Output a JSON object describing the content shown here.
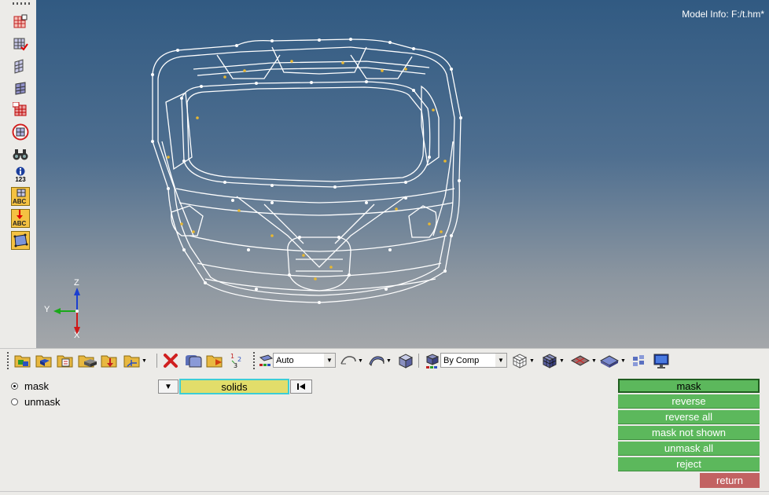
{
  "viewport": {
    "model_info": "Model Info: F:/t.hm*",
    "axis": {
      "z": "Z",
      "y": "Y",
      "x": "X"
    }
  },
  "left_toolbar": {
    "icons": [
      "mesh-box-icon",
      "mesh-check-icon",
      "mesh-plane-icon",
      "mesh-solid-icon",
      "mesh-red-icon",
      "mesh-circle-icon",
      "binoculars-icon",
      "info-123-icon",
      "abc-grid-icon",
      "abc-arrow-icon",
      "rect-select-icon"
    ],
    "info_label": "123",
    "abc_label": "ABC"
  },
  "toolbar": {
    "mesh_mode": "Auto",
    "color_mode": "By Comp"
  },
  "panel": {
    "radio_mask": "mask",
    "radio_unmask": "unmask",
    "entity_selector": "solids",
    "buttons": {
      "mask": "mask",
      "reverse": "reverse",
      "reverse_all": "reverse all",
      "mask_not_shown": "mask not shown",
      "unmask_all": "unmask all",
      "reject": "reject",
      "return": "return"
    }
  },
  "colors": {
    "active_green": "#5cb85c",
    "return_red": "#c26262",
    "selector_yellow": "#e2dd6a",
    "selector_border": "#3ccdd6"
  }
}
